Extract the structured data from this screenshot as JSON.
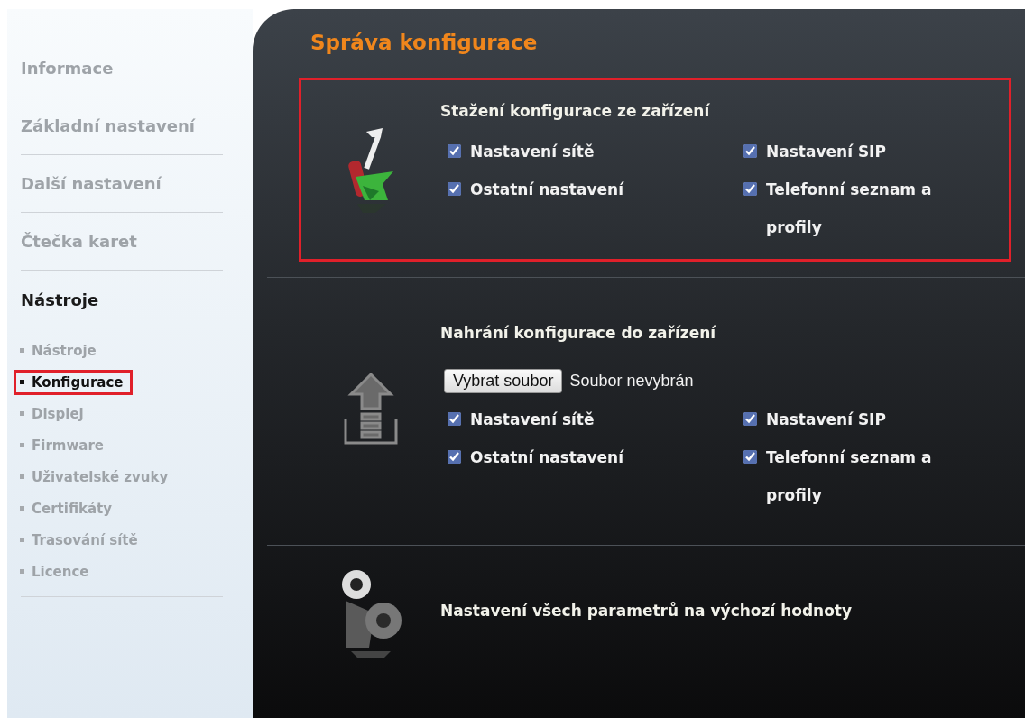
{
  "sidebar": {
    "items": [
      {
        "label": "Informace"
      },
      {
        "label": "Základní nastavení"
      },
      {
        "label": "Další nastavení"
      },
      {
        "label": "Čtečka karet"
      }
    ],
    "section": {
      "title": "Nástroje",
      "items": [
        {
          "label": "Nástroje",
          "selected": false,
          "highlighted": false
        },
        {
          "label": "Konfigurace",
          "selected": true,
          "highlighted": true
        },
        {
          "label": "Displej",
          "selected": false,
          "highlighted": false
        },
        {
          "label": "Firmware",
          "selected": false,
          "highlighted": false
        },
        {
          "label": "Uživatelské zvuky",
          "selected": false,
          "highlighted": false
        },
        {
          "label": "Certifikáty",
          "selected": false,
          "highlighted": false
        },
        {
          "label": "Trasování sítě",
          "selected": false,
          "highlighted": false
        },
        {
          "label": "Licence",
          "selected": false,
          "highlighted": false
        }
      ]
    }
  },
  "main": {
    "title": "Správa konfigurace",
    "sections": [
      {
        "kind": "download",
        "title": "Stažení konfigurace ze zařízení",
        "highlighted": true,
        "options": [
          {
            "label": "Nastavení sítě",
            "checked": true
          },
          {
            "label": "Nastavení SIP",
            "checked": true
          },
          {
            "label": "Ostatní nastavení",
            "checked": true
          },
          {
            "label": "Telefonní seznam a profily",
            "checked": true
          }
        ]
      },
      {
        "kind": "upload",
        "title": "Nahrání konfigurace do zařízení",
        "highlighted": false,
        "file_button": "Vybrat soubor",
        "file_status": "Soubor nevybrán",
        "options": [
          {
            "label": "Nastavení sítě",
            "checked": true
          },
          {
            "label": "Nastavení SIP",
            "checked": true
          },
          {
            "label": "Ostatní nastavení",
            "checked": true
          },
          {
            "label": "Telefonní seznam a profily",
            "checked": true
          }
        ]
      },
      {
        "kind": "reset",
        "title": "Nastavení všech parametrů na výchozí hodnoty",
        "highlighted": false
      }
    ]
  }
}
